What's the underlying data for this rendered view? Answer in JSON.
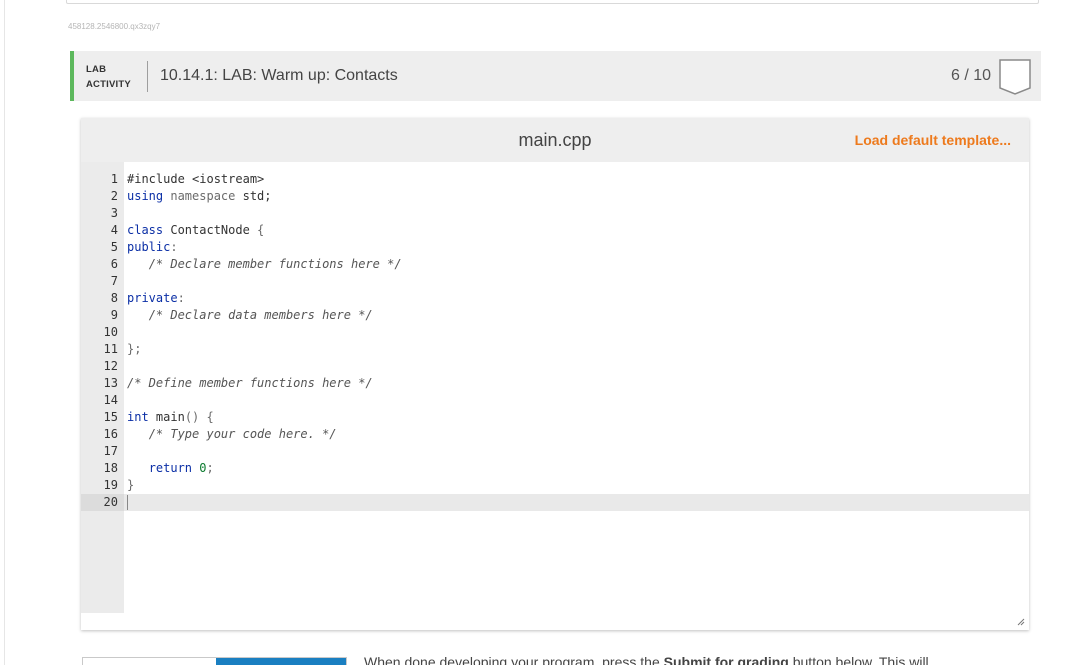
{
  "session_id": "458128.2546800.qx3zqy7",
  "lab": {
    "tag_line1": "LAB",
    "tag_line2": "ACTIVITY",
    "title": "10.14.1: LAB: Warm up: Contacts",
    "score": "6 / 10",
    "accent_color": "#5cb85c",
    "badge_icon": "shield-badge-icon"
  },
  "editor": {
    "file_name": "main.cpp",
    "load_template": "Load default template...",
    "link_color": "#ed7a1d",
    "active_line": 20,
    "lines": [
      [
        {
          "t": "#include <iostream>",
          "c": ""
        }
      ],
      [
        {
          "t": "using",
          "c": "kw"
        },
        {
          "t": " namespace ",
          "c": "mut"
        },
        {
          "t": "std;",
          "c": ""
        }
      ],
      [],
      [
        {
          "t": "class",
          "c": "kw"
        },
        {
          "t": " ContactNode ",
          "c": ""
        },
        {
          "t": "{",
          "c": "mut"
        }
      ],
      [
        {
          "t": "public",
          "c": "kw"
        },
        {
          "t": ":",
          "c": "mut"
        }
      ],
      [
        {
          "t": "   ",
          "c": ""
        },
        {
          "t": "/* Declare member functions here */",
          "c": "cm"
        }
      ],
      [],
      [
        {
          "t": "private",
          "c": "kw"
        },
        {
          "t": ":",
          "c": "mut"
        }
      ],
      [
        {
          "t": "   ",
          "c": ""
        },
        {
          "t": "/* Declare data members here */",
          "c": "cm"
        }
      ],
      [],
      [
        {
          "t": "};",
          "c": "mut"
        }
      ],
      [],
      [
        {
          "t": "/* Define member functions here */",
          "c": "cm"
        }
      ],
      [],
      [
        {
          "t": "int",
          "c": "kw"
        },
        {
          "t": " main",
          "c": ""
        },
        {
          "t": "() {",
          "c": "mut"
        }
      ],
      [
        {
          "t": "   ",
          "c": ""
        },
        {
          "t": "/* Type your code here. */",
          "c": "cm"
        }
      ],
      [],
      [
        {
          "t": "   ",
          "c": ""
        },
        {
          "t": "return",
          "c": "kw"
        },
        {
          "t": " ",
          "c": ""
        },
        {
          "t": "0",
          "c": "num"
        },
        {
          "t": ";",
          "c": "mut"
        }
      ],
      [
        {
          "t": "}",
          "c": "mut"
        }
      ],
      []
    ]
  },
  "instruction": {
    "before": "When done developing your program, press the ",
    "bold": "Submit for grading",
    "after": " button below. This will"
  }
}
